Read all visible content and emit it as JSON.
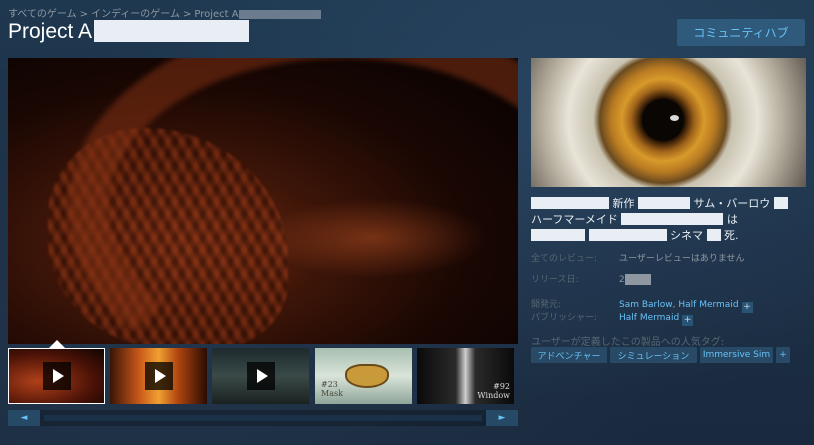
{
  "breadcrumb": {
    "items": [
      "すべてのゲーム",
      "インディーのゲーム",
      "Project A"
    ],
    "separator": ">"
  },
  "page_title": "Project A",
  "community_hub_label": "コミュニティハブ",
  "media": {
    "thumbnails": [
      {
        "type": "video",
        "selected": true
      },
      {
        "type": "video",
        "selected": false
      },
      {
        "type": "video",
        "selected": false
      },
      {
        "type": "image",
        "caption_number": "#23",
        "caption_word": "Mask"
      },
      {
        "type": "image",
        "caption_number": "#92",
        "caption_word": "Window"
      }
    ],
    "scroll_left_label": "◄",
    "scroll_right_label": "►"
  },
  "description": {
    "line1_word1": "新作",
    "line1_word2": "サム・バーロウ",
    "line2_word1": "ハーフマーメイド",
    "line2_word2": "は",
    "line3_word1": "シネマ",
    "line3_word2": "死."
  },
  "reviews": {
    "label": "全てのレビュー:",
    "value": "ユーザーレビューはありません"
  },
  "release": {
    "label": "リリース日:",
    "value": "2"
  },
  "developer": {
    "label": "開発元:",
    "values": [
      "Sam Barlow",
      "Half Mermaid"
    ],
    "separator": ","
  },
  "publisher": {
    "label": "パブリッシャー:",
    "value": "Half Mermaid"
  },
  "tags": {
    "title": "ユーザーが定義したこの製品への人気タグ:",
    "items": [
      "アドベンチャー",
      "シミュレーション",
      "Immersive Sim"
    ],
    "more_label": "+"
  },
  "plus_label": "+",
  "colors": {
    "link": "#67c1f5",
    "background": "#1b2838",
    "tag_bg": "#284a66"
  }
}
